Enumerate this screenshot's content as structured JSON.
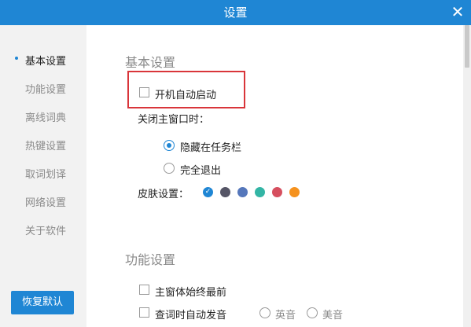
{
  "window": {
    "title": "设置",
    "close_glyph": "✕"
  },
  "sidebar": {
    "items": [
      {
        "label": "基本设置",
        "active": true
      },
      {
        "label": "功能设置"
      },
      {
        "label": "离线词典"
      },
      {
        "label": "热键设置"
      },
      {
        "label": "取词划译"
      },
      {
        "label": "网络设置"
      },
      {
        "label": "关于软件"
      }
    ],
    "restore_button": "恢复默认"
  },
  "basic": {
    "section_title": "基本设置",
    "autostart_label": "开机自动启动",
    "close_label": "关闭主窗口时：",
    "close_options": [
      "隐藏在任务栏",
      "完全退出"
    ],
    "skin_label": "皮肤设置：",
    "skins": [
      "#1f86d4",
      "#555566",
      "#5577bb",
      "#33b5a5",
      "#d64f5f",
      "#f5921e"
    ],
    "selected_skin_mark": "✓"
  },
  "function": {
    "section_title": "功能设置",
    "always_on_top_label": "主窗体始终最前",
    "auto_pronounce_label": "查词时自动发音",
    "accent_options": [
      "英音",
      "美音"
    ]
  }
}
